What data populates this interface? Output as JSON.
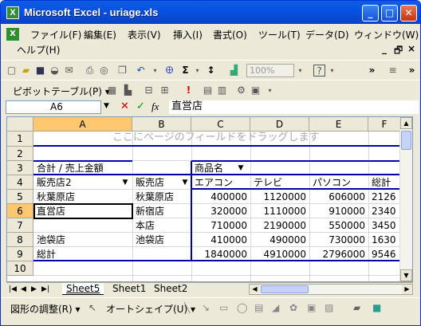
{
  "window": {
    "title": "Microsoft Excel - uriage.xls",
    "app_icon": "X"
  },
  "menu": [
    "ファイル(F)",
    "編集(E)",
    "表示(V)",
    "挿入(I)",
    "書式(O)",
    "ツール(T)",
    "データ(D)",
    "ウィンドウ(W)",
    "ヘルプ(H)"
  ],
  "toolbar": {
    "zoom": "100%",
    "pivot_label": "ピボットテーブル(P) ▾"
  },
  "formula_bar": {
    "name_box": "A6",
    "fx": "fx",
    "content": "直営店"
  },
  "columns": [
    "A",
    "B",
    "C",
    "D",
    "E",
    "F"
  ],
  "rows": [
    "1",
    "2",
    "3",
    "4",
    "5",
    "6",
    "7",
    "8",
    "9",
    "10"
  ],
  "cells": {
    "page_drop": "ここにページのフィールドをドラッグします",
    "a3": "合計 / 売上金額",
    "c3": "商品名",
    "a4": "販売店2",
    "b4": "販売店",
    "c4": "エアコン",
    "d4": "テレビ",
    "e4": "パソコン",
    "f4": "総計",
    "a5": "秋葉原店",
    "b5": "秋葉原店",
    "c5": "400000",
    "d5": "1120000",
    "e5": "606000",
    "f5": "2126",
    "a6": "直営店",
    "b6": "新宿店",
    "c6": "320000",
    "d6": "1110000",
    "e6": "910000",
    "f6": "2340",
    "b7": "本店",
    "c7": "710000",
    "d7": "2190000",
    "e7": "550000",
    "f7": "3450",
    "a8": "池袋店",
    "b8": "池袋店",
    "c8": "410000",
    "d8": "490000",
    "e8": "730000",
    "f8": "1630",
    "a9": "総計",
    "c9": "1840000",
    "d9": "4910000",
    "e9": "2796000",
    "f9": "9546"
  },
  "sheets": [
    "Sheet5",
    "Sheet1",
    "Sheet2"
  ],
  "drawing": {
    "adjust": "図形の調整(R) ▾",
    "autoshape": "オートシェイプ(U) ▾"
  }
}
